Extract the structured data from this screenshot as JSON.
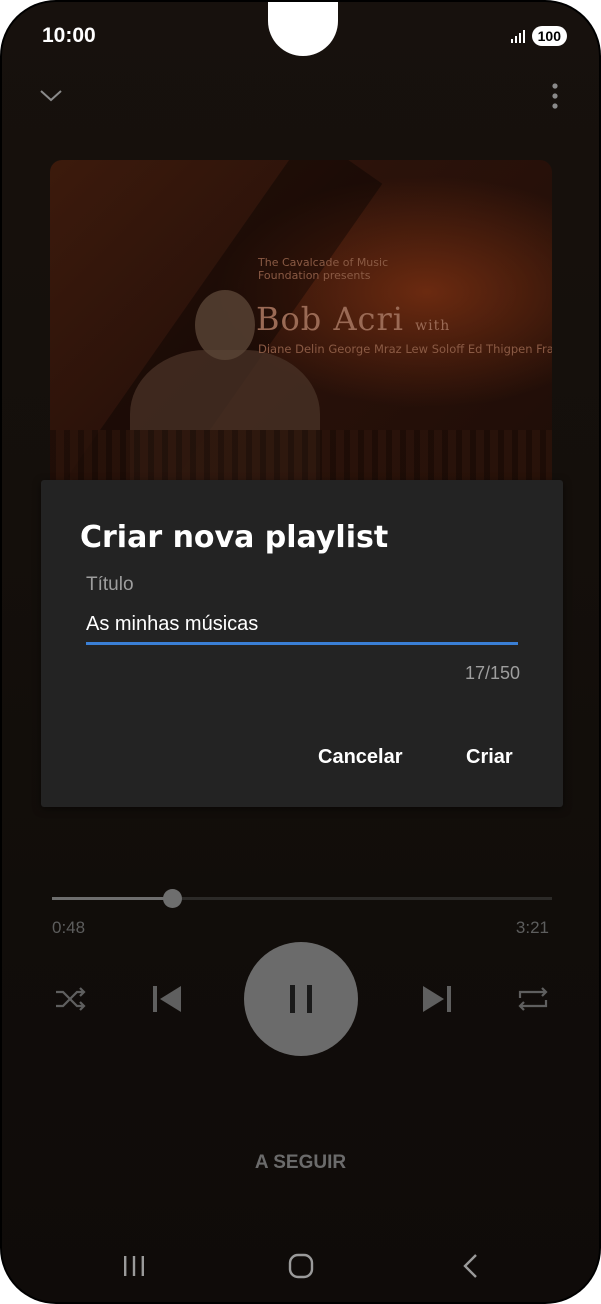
{
  "status_bar": {
    "time": "10:00",
    "battery": "100",
    "signal_icon": "signal-icon"
  },
  "header": {
    "collapse_icon": "chevron-down-icon",
    "more_icon": "more-vertical-icon"
  },
  "album_art": {
    "presenter_text": "The Cavalcade of Music Foundation presents",
    "artist_text": "Bob Acri",
    "artist_with": "with",
    "names_text": "Diane Delin George Mraz Lew Soloff Ed Thigpen Frank Wess"
  },
  "dialog": {
    "title": "Criar nova playlist",
    "field_label": "Título",
    "field_value": "As minhas músicas",
    "counter": "17/150",
    "cancel_label": "Cancelar",
    "create_label": "Criar",
    "accent_color": "#3a7fd5"
  },
  "player": {
    "elapsed": "0:48",
    "duration": "3:21",
    "progress_fraction": 0.239,
    "shuffle_icon": "shuffle-icon",
    "previous_icon": "skip-previous-icon",
    "play_pause_icon": "pause-icon",
    "next_icon": "skip-next-icon",
    "repeat_icon": "repeat-icon"
  },
  "up_next": {
    "label": "A SEGUIR"
  },
  "nav_bar": {
    "recents_icon": "recents-icon",
    "home_icon": "home-icon",
    "back_icon": "back-icon"
  }
}
